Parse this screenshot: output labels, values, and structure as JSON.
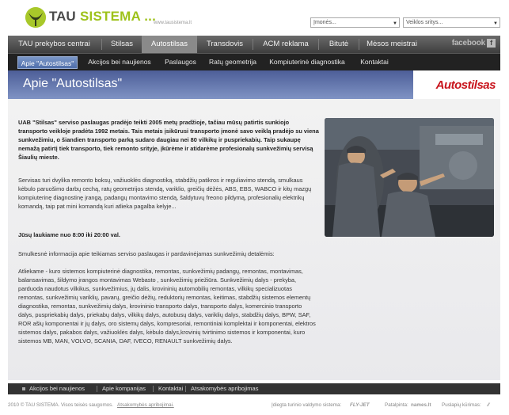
{
  "header": {
    "logo_tau": "TAU",
    "logo_sistema": "SISTEMA ...",
    "url": "www.tausistema.lt",
    "select_companies": "Įmonės...",
    "select_activities": "Veiklos sritys..."
  },
  "main_nav": {
    "items": [
      "TAU prekybos centrai",
      "Stilsas",
      "Autostilsas",
      "Transdovis",
      "ACM reklama",
      "Bitutė",
      "Mėsos meistrai"
    ],
    "active": "Autostilsas",
    "facebook_label": "facebook",
    "facebook_icon": "f"
  },
  "sub_nav": {
    "items": [
      "Apie \"Autostilsas\"",
      "Akcijos bei naujienos",
      "Paslaugos",
      "Ratų geometrija",
      "Kompiuterinė diagnostika",
      "Kontaktai"
    ],
    "active": "Apie \"Autostilsas\""
  },
  "page": {
    "title": "Apie \"Autostilsas\"",
    "brand_logo": "Autostilsas",
    "intro": "UAB \"Stilsas\" serviso paslaugas pradėjo teikti 2005 metų pradžioje, tačiau mūsų patirtis sunkiojo transporto veikloje pradėta 1992 metais. Tais metais įsikūrusi transporto įmonė savo veiklą pradėjo su viena sunkvežimiu, o šiandien transporto parką sudaro daugiau nei 80 vilkikų ir puspriekabių. Taip sukaupę nemažą patirtį tiek transporto, tiek remonto srityje, įkūrėme ir atidarėme profesionalų sunkvežimių servisą Šiaulių mieste.",
    "services": "Servisas turi dvylika remonto boksų, važiuoklės diagnostiką, stabdžių patikros ir reguliavimo stendą, smulkaus kėbulo paruošimo darbų cechą, ratų geometrijos stendą, variklio, greičių dėžės, ABS, EBS, WABCO ir kitų mazgų kompiuterinę diagnostinę įrangą, padangų montavimo stendą, šaldytuvų freono pildymą, profesionalių elektrikų komandą, taip pat mini komandą kuri atlieka pagalba kelyje...",
    "hours": "Jūsų laukiame nuo 8:00 iki 20:00 val.",
    "details_intro": "Smulkesnė informacija apie teikiamas serviso paslaugas ir pardavinėjamas sunkvežimių detalėmis:",
    "details": "Atliekame - kuro sistemos kompiuterinė diagnostika, remontas, sunkvežimių padangų, remontas, montavimas, balansavimas, šildymo įrangos montavimas Webasto , sunkvežimių priežiūra. Sunkvežimių dalys - prekyba, parduoda naudotus vilkikus, sunkvežimius, jų dalis, krovininių automobilių remontas, vilkikų specializuotas remontas, sunkvežimių variklių, pavarų, greičio dėžių, reduktorių remontas, keitimas, stabdžių sistemos elementų diagnostika, remontas, sunkvežimių dalys, krovininio transporto dalys, transporto dalys, komercinio transporto dalys, puspriekabių dalys, priekabų dalys, vilkikų dalys, autobusų dalys, variklių dalys, stabdžių dalys, BPW, SAF, ROR ašių komponentai ir jų dalys, oro sistemų dalys, kompresoriai, remontiniai komplektai ir komponentai, elektros sistemos dalys, pakabos dalys, važiuoklės dalys, kėbulo dalys,krovinių tvirtinimo sistemos ir komponentai, kuro sistemos MB, MAN, VOLVO, SCANIA, DAF, IVECO, RENAULT sunkvežimių dalys."
  },
  "footer": {
    "links": [
      "Akcijos bei naujienos",
      "Apie kompanijas",
      "Kontaktai",
      "Atsakomybės apribojimas"
    ]
  },
  "bottom": {
    "copyright": "2010 © TAU SISTEMA. Visos teisės saugomos.",
    "disclaimer": "Atsakomybės apribojimai.",
    "cms_label": "Įdiegta turinio valdymo sistema:",
    "cms_logo": "FLY-JET",
    "host_label": "Patalpinta:",
    "host_logo": "names.lt",
    "design_label": "Puslapių kūrimas:"
  }
}
